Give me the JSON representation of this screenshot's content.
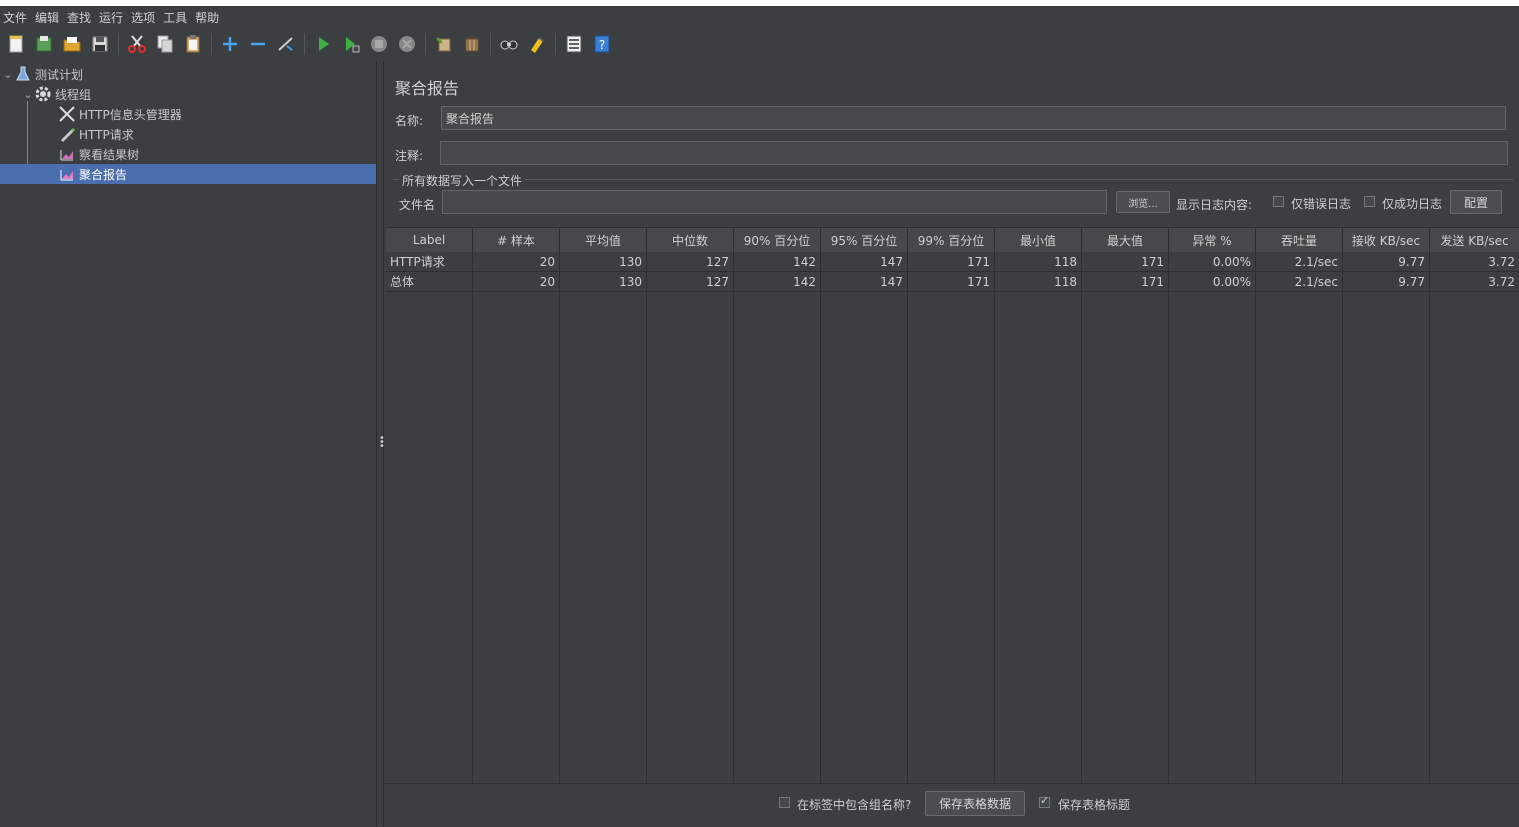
{
  "menu": [
    "文件",
    "编辑",
    "查找",
    "运行",
    "选项",
    "工具",
    "帮助"
  ],
  "toolbar": {
    "groups": [
      [
        "new-icon",
        "templates-icon",
        "open-icon",
        "save-icon"
      ],
      [
        "cut-icon",
        "copy-icon",
        "paste-icon"
      ],
      [
        "expand-icon",
        "collapse-icon",
        "toggle-icon"
      ],
      [
        "start-icon",
        "start-no-pause-icon",
        "stop-icon",
        "shutdown-icon"
      ],
      [
        "clear-icon",
        "clear-all-icon"
      ],
      [
        "search-icon",
        "reset-search-icon"
      ],
      [
        "function-helper-icon",
        "help-icon"
      ]
    ]
  },
  "tree": {
    "items": [
      {
        "label": "测试计划",
        "icon": "test-plan-icon",
        "level": 0,
        "expanded": true
      },
      {
        "label": "线程组",
        "icon": "gear-icon",
        "level": 1,
        "expanded": true
      },
      {
        "label": "HTTP信息头管理器",
        "icon": "wrench-icon",
        "level": 2
      },
      {
        "label": "HTTP请求",
        "icon": "pen-icon",
        "level": 2
      },
      {
        "label": "察看结果树",
        "icon": "chart-icon",
        "level": 2
      },
      {
        "label": "聚合报告",
        "icon": "chart-icon",
        "level": 2,
        "selected": true
      }
    ]
  },
  "panel": {
    "title": "聚合报告",
    "name_label": "名称:",
    "name_value": "聚合报告",
    "comment_label": "注释:",
    "comment_value": "",
    "file_group_title": "所有数据写入一个文件",
    "filename_label": "文件名",
    "filename_value": "",
    "browse_button": "浏览...",
    "log_content_label": "显示日志内容:",
    "errors_only_label": "仅错误日志",
    "success_only_label": "仅成功日志",
    "configure_button": "配置"
  },
  "table": {
    "headers": [
      "Label",
      "# 样本",
      "平均值",
      "中位数",
      "90% 百分位",
      "95% 百分位",
      "99% 百分位",
      "最小值",
      "最大值",
      "异常 %",
      "吞吐量",
      "接收 KB/sec",
      "发送 KB/sec"
    ],
    "rows": [
      [
        "HTTP请求",
        "20",
        "130",
        "127",
        "142",
        "147",
        "171",
        "118",
        "171",
        "0.00%",
        "2.1/sec",
        "9.77",
        "3.72"
      ],
      [
        "总体",
        "20",
        "130",
        "127",
        "142",
        "147",
        "171",
        "118",
        "171",
        "0.00%",
        "2.1/sec",
        "9.77",
        "3.72"
      ]
    ]
  },
  "bottom": {
    "include_group_label": "在标签中包含组名称?",
    "include_group_checked": false,
    "save_table_button": "保存表格数据",
    "save_header_label": "保存表格标题",
    "save_header_checked": true
  },
  "colors": {
    "background": "#3c3f41",
    "selection": "#4b6eaf",
    "field": "#45494a"
  }
}
